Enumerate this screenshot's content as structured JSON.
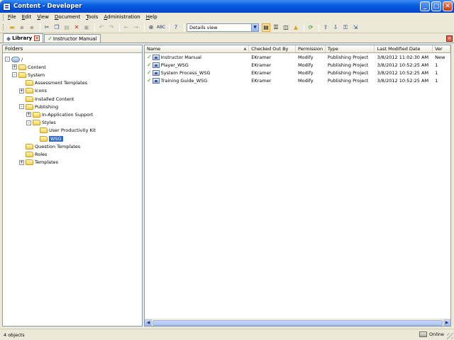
{
  "window": {
    "title": "Content - Developer"
  },
  "menu": [
    "File",
    "Edit",
    "View",
    "Document",
    "Tools",
    "Administration",
    "Help"
  ],
  "toolbar": {
    "view_mode": "Details view"
  },
  "tabs": [
    {
      "label": "Library",
      "icon": "library-icon",
      "closable": true
    },
    {
      "label": "Instructor Manual",
      "icon": "check-doc-icon",
      "closable": false
    }
  ],
  "folders": {
    "header": "Folders",
    "items": [
      {
        "label": "/",
        "depth": 0,
        "toggle": "-",
        "type": "root"
      },
      {
        "label": "Content",
        "depth": 1,
        "toggle": "+"
      },
      {
        "label": "System",
        "depth": 1,
        "toggle": "-"
      },
      {
        "label": "Assessment Templates",
        "depth": 2,
        "toggle": ""
      },
      {
        "label": "Icons",
        "depth": 2,
        "toggle": "+"
      },
      {
        "label": "Installed Content",
        "depth": 2,
        "toggle": ""
      },
      {
        "label": "Publishing",
        "depth": 2,
        "toggle": "-"
      },
      {
        "label": "In-Application Support",
        "depth": 3,
        "toggle": "+"
      },
      {
        "label": "Styles",
        "depth": 3,
        "toggle": "-"
      },
      {
        "label": "User Productivity Kit",
        "depth": 4,
        "toggle": ""
      },
      {
        "label": "WSG",
        "depth": 4,
        "toggle": "",
        "selected": true
      },
      {
        "label": "Question Templates",
        "depth": 2,
        "toggle": ""
      },
      {
        "label": "Roles",
        "depth": 2,
        "toggle": ""
      },
      {
        "label": "Templates",
        "depth": 2,
        "toggle": "+"
      }
    ]
  },
  "details": {
    "columns": [
      "Name",
      "Checked Out By",
      "Permission",
      "Type",
      "Last Modified Date",
      "Ver"
    ],
    "rows": [
      [
        "Instructor Manual",
        "EKramer",
        "Modify",
        "Publishing Project",
        "3/8/2012 11:02:30 AM",
        "New"
      ],
      [
        "Player_WSG",
        "EKramer",
        "Modify",
        "Publishing Project",
        "3/8/2012 10:52:25 AM",
        "1"
      ],
      [
        "System Process_WSG",
        "EKramer",
        "Modify",
        "Publishing Project",
        "3/8/2012 10:52:25 AM",
        "1"
      ],
      [
        "Training Guide_WSG",
        "EKramer",
        "Modify",
        "Publishing Project",
        "3/8/2012 10:52:25 AM",
        "1"
      ]
    ]
  },
  "status": {
    "count": "4 objects",
    "connection": "Online"
  }
}
